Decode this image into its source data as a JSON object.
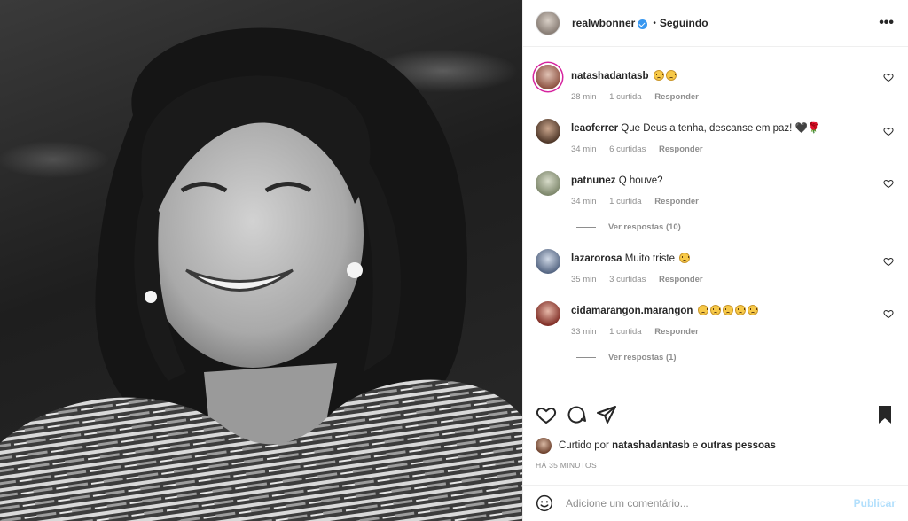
{
  "post": {
    "username": "realwbonner",
    "separator": "•",
    "follow_status": "Seguindo",
    "more_icon": "⋮"
  },
  "comments": [
    {
      "username": "natashadantasb",
      "text": "",
      "emoji_count": 2,
      "time": "28 min",
      "likes": "1 curtida",
      "reply": "Responder",
      "avatar_color": "#c58a7a"
    },
    {
      "username": "leaoferrer",
      "text": "Que Deus a tenha, descanse em paz!",
      "trailing_icons": "🖤🌹",
      "time": "34 min",
      "likes": "6 curtidas",
      "reply": "Responder",
      "avatar_color": "#6b5444"
    },
    {
      "username": "patnunez",
      "text": "Q houve?",
      "time": "34 min",
      "likes": "1 curtida",
      "reply": "Responder",
      "view_replies": "Ver respostas (10)",
      "avatar_color": "#9aa38d"
    },
    {
      "username": "lazarorosa",
      "text": "Muito triste",
      "emoji_count": 1,
      "time": "35 min",
      "likes": "3 curtidas",
      "reply": "Responder",
      "avatar_color": "#7f95b8"
    },
    {
      "username": "cidamarangon.marangon",
      "text": "",
      "emoji_count": 5,
      "time": "33 min",
      "likes": "1 curtida",
      "reply": "Responder",
      "view_replies": "Ver respostas (1)",
      "avatar_color": "#a0473c"
    }
  ],
  "likes_line": {
    "prefix": "Curtido por",
    "user": "natashadantasb",
    "connector": "e",
    "others": "outras pessoas"
  },
  "timestamp": "HÁ 35 MINUTOS",
  "comment_box": {
    "placeholder": "Adicione um comentário...",
    "publish": "Publicar"
  },
  "colors": {
    "link_blue": "#3897f0",
    "publish_disabled": "#b2dffc",
    "meta_gray": "#8e8e8e"
  }
}
